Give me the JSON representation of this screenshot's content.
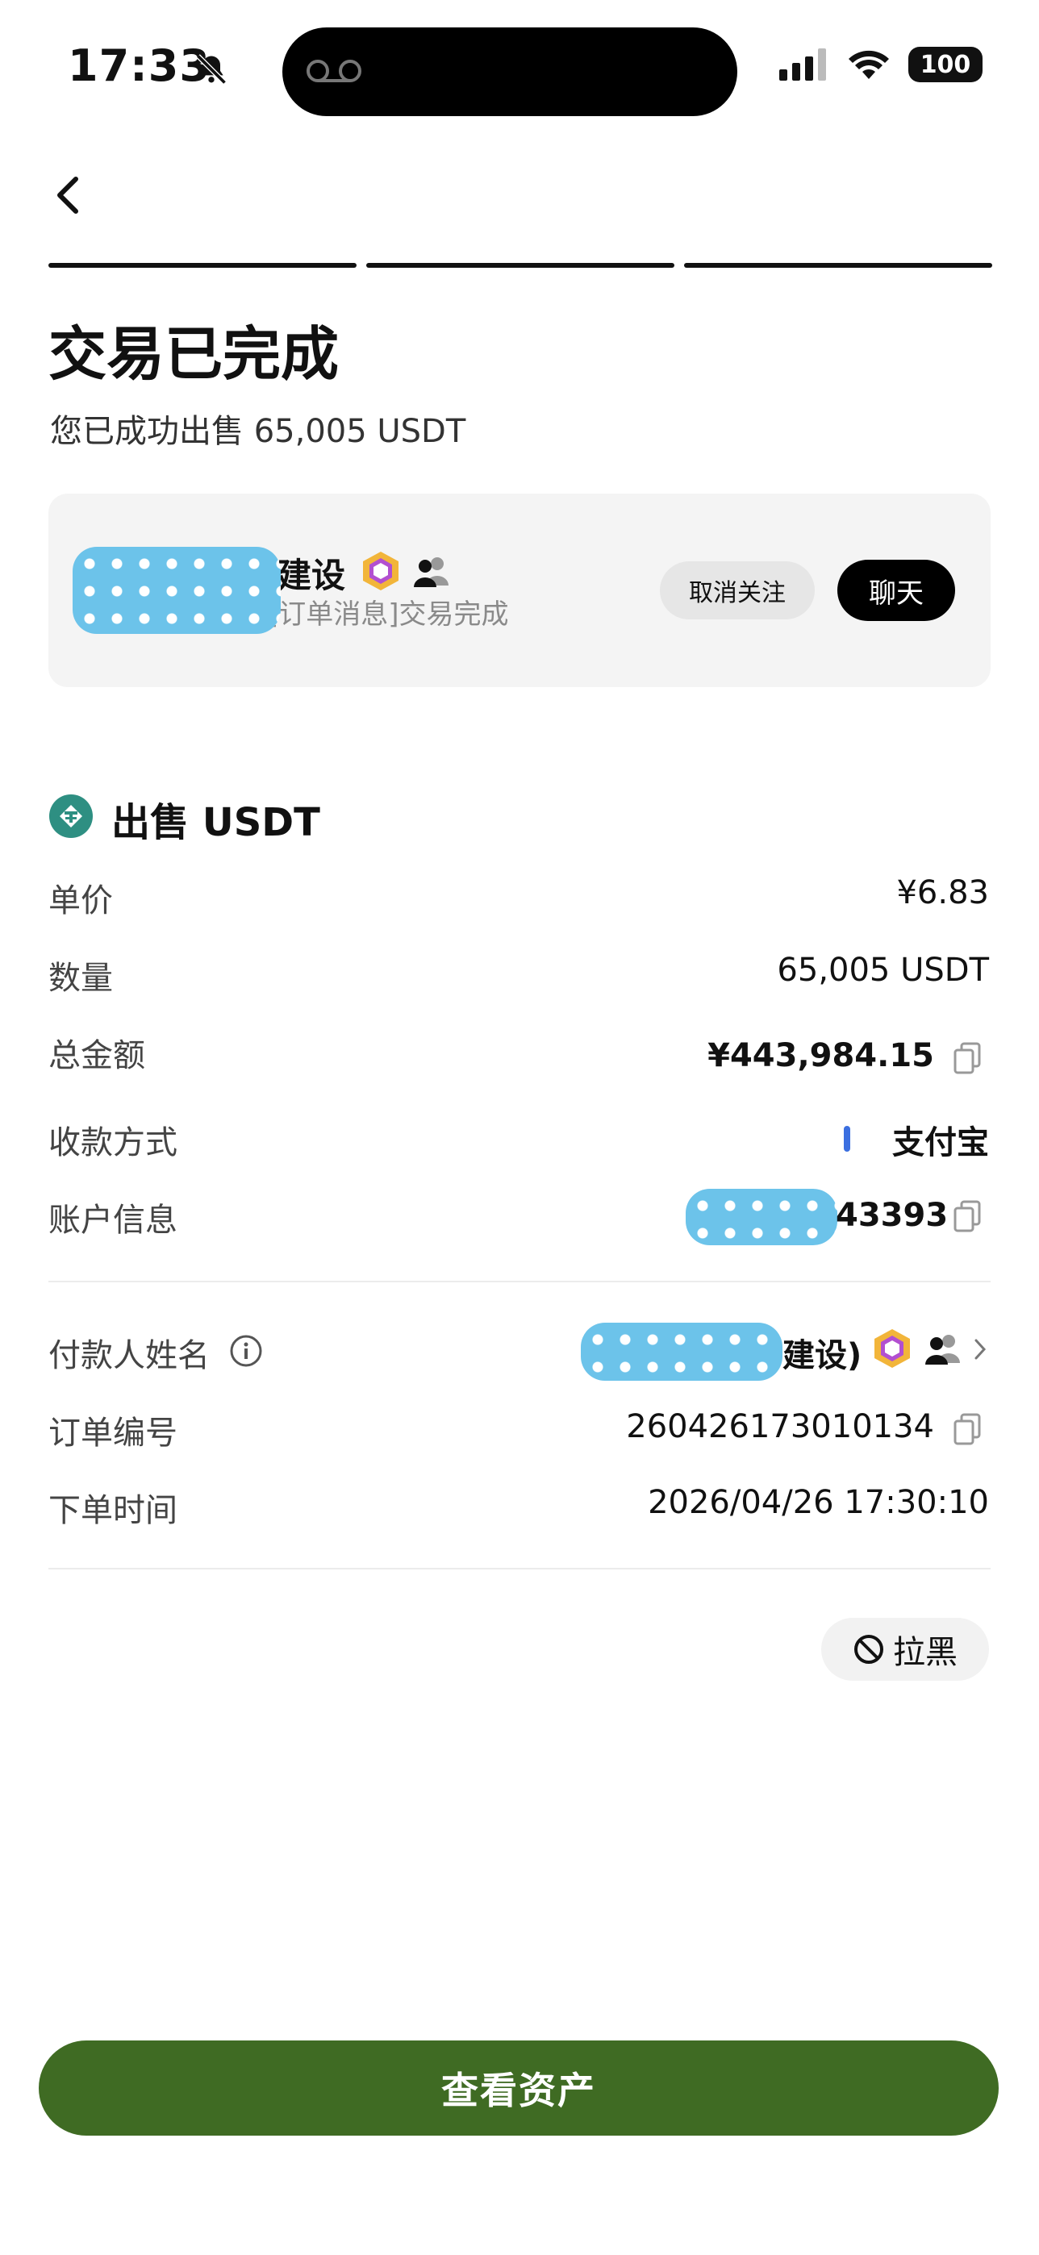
{
  "status_bar": {
    "time": "17:33",
    "battery": "100"
  },
  "header": {
    "title": "交易已完成",
    "subtitle": "您已成功出售 65,005 USDT"
  },
  "card": {
    "name_visible": "建设",
    "message": "[订单消息]交易完成",
    "unfollow_label": "取消关注",
    "chat_label": "聊天"
  },
  "section": {
    "title": "出售 USDT"
  },
  "details": {
    "price_label": "单价",
    "price_value": "¥6.83",
    "quantity_label": "数量",
    "quantity_value": "65,005 USDT",
    "total_label": "总金额",
    "total_value": "¥443,984.15",
    "method_label": "收款方式",
    "method_value": "支付宝",
    "account_label": "账户信息",
    "account_value_tail": "43393",
    "payer_label": "付款人姓名",
    "payer_value_tail": "建设)",
    "order_label": "订单编号",
    "order_value": "260426173010134",
    "time_label": "下单时间",
    "time_value": "2026/04/26 17:30:10"
  },
  "block_label": "拉黑",
  "primary_button": "查看资产",
  "colors": {
    "primary_green": "#3f6b23",
    "alipay_blue": "#3b6fe0",
    "coin_teal": "#2e8f82"
  },
  "icons": [
    "bell-slash-icon",
    "voicemail-icon",
    "signal-icon",
    "wifi-icon",
    "back-chevron-icon",
    "badge-hexagon-icon",
    "group-icon",
    "tether-coin-icon",
    "copy-icon",
    "info-icon",
    "chevron-right-icon",
    "block-icon"
  ]
}
